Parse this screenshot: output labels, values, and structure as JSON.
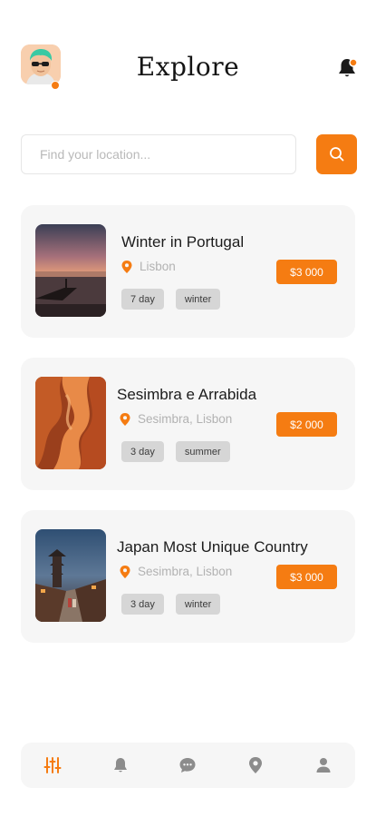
{
  "header": {
    "title": "Explore",
    "avatar": "user-avatar",
    "notification_icon": "bell-icon",
    "has_notification": true
  },
  "search": {
    "placeholder": "Find your location...",
    "value": "",
    "button_icon": "search-icon"
  },
  "colors": {
    "accent": "#f57c12",
    "card_bg": "#f6f6f6",
    "tag_bg": "#d6d6d6",
    "muted_text": "#b2b2b2"
  },
  "trips": [
    {
      "title": "Winter in Portugal",
      "location": "Lisbon",
      "tags": [
        "7 day",
        "winter"
      ],
      "price": "$3 000",
      "image": "sunset-boat-photo"
    },
    {
      "title": "Sesimbra e Arrabida",
      "location": "Sesimbra, Lisbon",
      "tags": [
        "3 day",
        "summer"
      ],
      "price": "$2 000",
      "image": "canyon-rock-photo"
    },
    {
      "title": "Japan Most Unique Country",
      "location": "Sesimbra, Lisbon",
      "tags": [
        "3 day",
        "winter"
      ],
      "price": "$3 000",
      "image": "pagoda-street-photo"
    }
  ],
  "bottom_nav": {
    "items": [
      {
        "icon": "sliders-icon",
        "active": true
      },
      {
        "icon": "bell-icon",
        "active": false
      },
      {
        "icon": "chat-icon",
        "active": false
      },
      {
        "icon": "map-pin-icon",
        "active": false
      },
      {
        "icon": "user-icon",
        "active": false
      }
    ]
  }
}
